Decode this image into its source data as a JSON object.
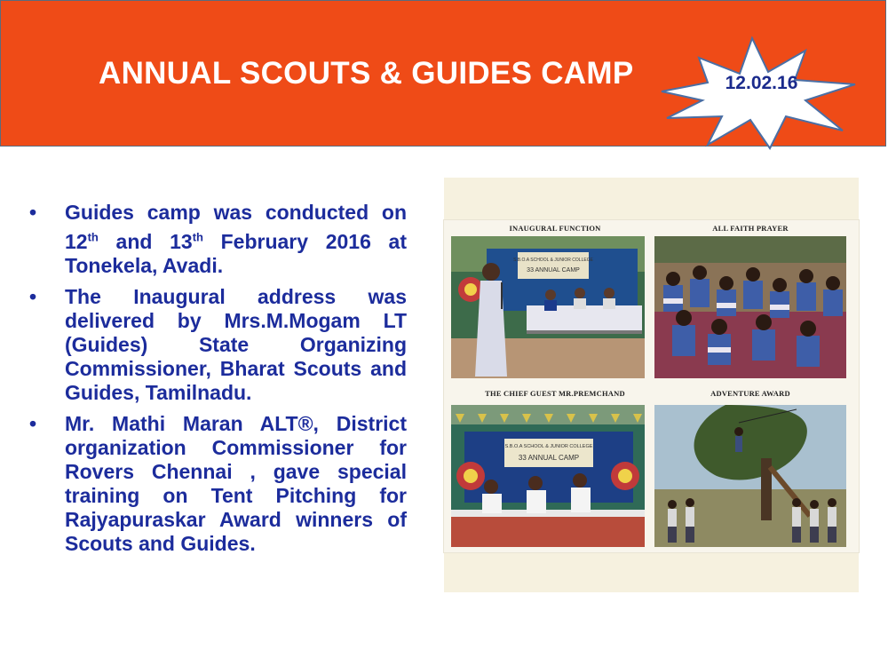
{
  "header": {
    "title": "ANNUAL SCOUTS & GUIDES CAMP",
    "date": "12.02.16",
    "background": "#EF4B17"
  },
  "bullets": [
    {
      "parts": [
        "Guides camp was conducted on 12",
        "th",
        " and 13",
        "th",
        " February 2016 at Tonekela, Avadi."
      ]
    },
    {
      "text": "The Inaugural address was delivered by Mrs.M.Mogam LT (Guides) State Organizing Commissioner, Bharat Scouts and Guides, Tamilnadu."
    },
    {
      "text": "Mr. Mathi Maran ALT®, District organization Commissioner for Rovers Chennai , gave special training on Tent Pitching for Rajyapuraskar Award winners of Scouts and Guides."
    }
  ],
  "bullet_symbol": "•",
  "collage": {
    "captions": [
      "INAUGURAL FUNCTION",
      "ALL FAITH PRAYER",
      "THE CHIEF GUEST MR.PREMCHAND",
      "ADVENTURE AWARD"
    ],
    "banner_text": {
      "school": "S.B.O.A SCHOOL & JUNIOR COLLEGE",
      "camp": "33 ANNUAL CAMP",
      "camp_sup": "rd"
    }
  }
}
